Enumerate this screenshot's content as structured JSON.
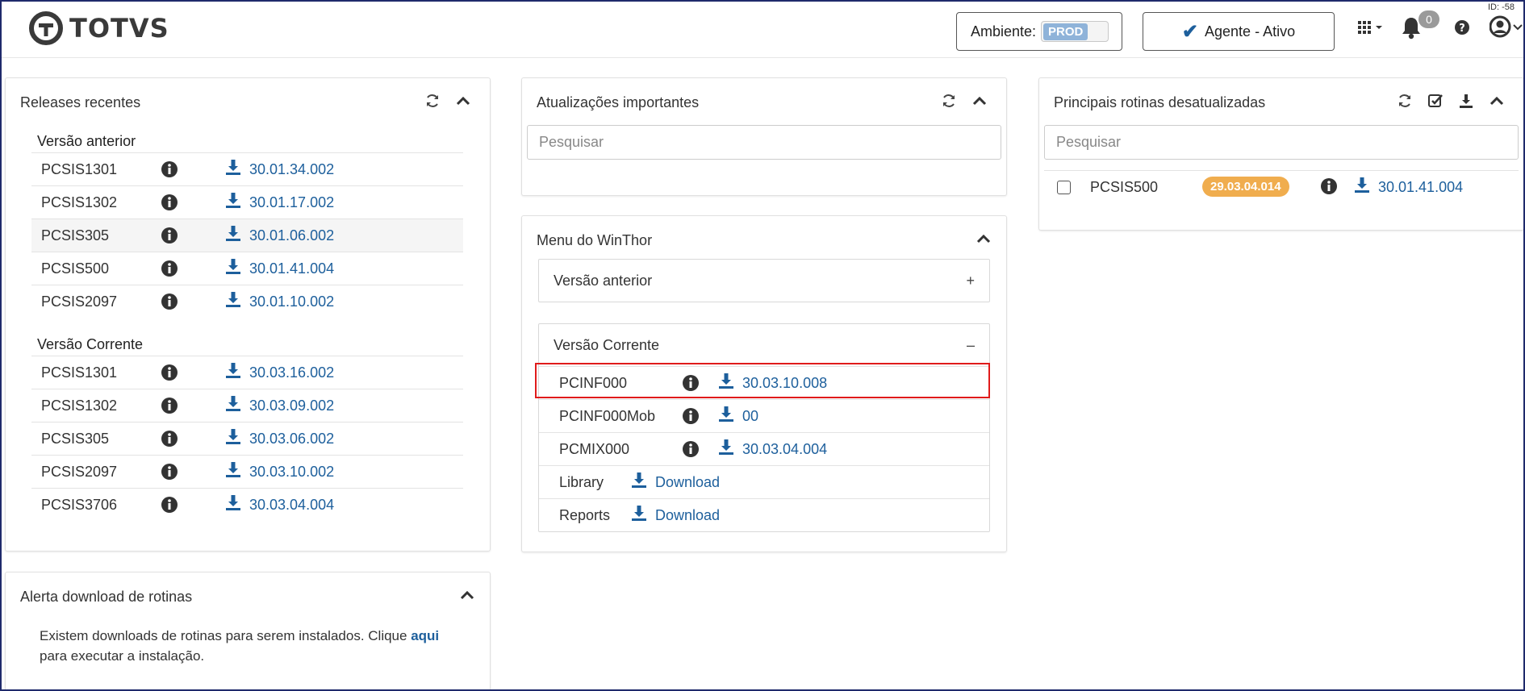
{
  "brand": {
    "name": "TOTVS"
  },
  "header": {
    "env_label": "Ambiente:",
    "env_value": "PROD",
    "agent_label": "Agente - Ativo",
    "notifications_count": "0",
    "id_label": "ID: -58"
  },
  "releases": {
    "title": "Releases recentes",
    "previous_title": "Versão anterior",
    "previous": [
      {
        "code": "PCSIS1301",
        "version": "30.01.34.002"
      },
      {
        "code": "PCSIS1302",
        "version": "30.01.17.002"
      },
      {
        "code": "PCSIS305",
        "version": "30.01.06.002"
      },
      {
        "code": "PCSIS500",
        "version": "30.01.41.004"
      },
      {
        "code": "PCSIS2097",
        "version": "30.01.10.002"
      }
    ],
    "current_title": "Versão Corrente",
    "current": [
      {
        "code": "PCSIS1301",
        "version": "30.03.16.002"
      },
      {
        "code": "PCSIS1302",
        "version": "30.03.09.002"
      },
      {
        "code": "PCSIS305",
        "version": "30.03.06.002"
      },
      {
        "code": "PCSIS2097",
        "version": "30.03.10.002"
      },
      {
        "code": "PCSIS3706",
        "version": "30.03.04.004"
      }
    ]
  },
  "alert": {
    "title": "Alerta download de rotinas",
    "text_before": "Existem downloads de rotinas para serem instalados. Clique ",
    "link": "aqui",
    "text_after": " para executar a instalação."
  },
  "updates": {
    "title": "Atualizações importantes",
    "search_placeholder": "Pesquisar"
  },
  "menu": {
    "title": "Menu do WinThor",
    "previous_label": "Versão anterior",
    "previous_sign": "+",
    "current_label": "Versão Corrente",
    "current_sign": "–",
    "items": [
      {
        "code": "PCINF000",
        "version": "30.03.10.008"
      },
      {
        "code": "PCINF000Mob",
        "version": "00"
      },
      {
        "code": "PCMIX000",
        "version": "30.03.04.004"
      },
      {
        "code": "Library",
        "version": "Download"
      },
      {
        "code": "Reports",
        "version": "Download"
      }
    ]
  },
  "outdated": {
    "title": "Principais rotinas desatualizadas",
    "search_placeholder": "Pesquisar",
    "items": [
      {
        "code": "PCSIS500",
        "installed": "29.03.04.014",
        "version": "30.01.41.004"
      }
    ]
  },
  "colors": {
    "link": "#1d5f9c",
    "badge": "#f0ad4e",
    "highlight": "#e01b1b"
  }
}
